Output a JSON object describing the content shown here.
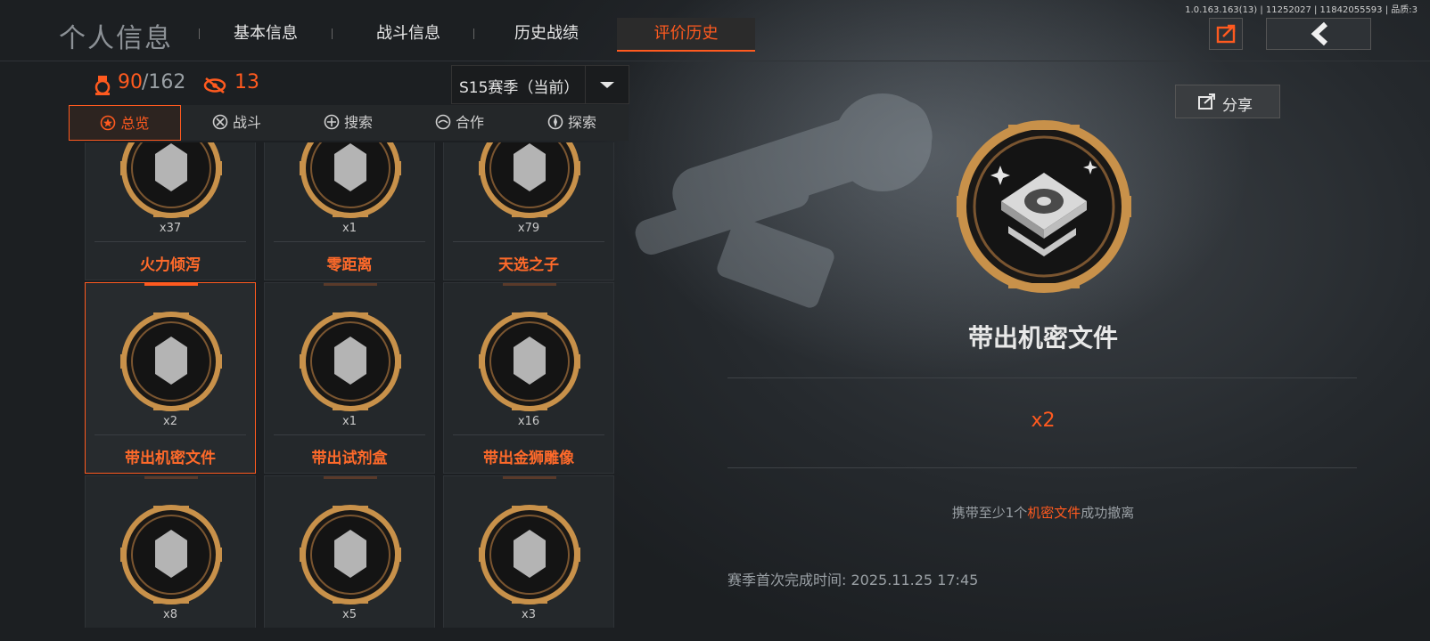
{
  "debug_text": "1.0.163.163(13) | 11252027 | 11842055593 | 品质:3",
  "header": {
    "title": "个人信息",
    "tabs": [
      {
        "label": "基本信息",
        "active": false
      },
      {
        "label": "战斗信息",
        "active": false
      },
      {
        "label": "历史战绩",
        "active": false
      },
      {
        "label": "评价历史",
        "active": true
      }
    ],
    "export_icon": "export-icon",
    "back_icon": "back-arrow-icon"
  },
  "stats": {
    "completed": "90",
    "total": "/162",
    "watch_count": "13"
  },
  "season": {
    "selected": "S15赛季（当前）"
  },
  "subtabs": [
    {
      "label": "总览",
      "icon": "star-icon",
      "active": true
    },
    {
      "label": "战斗",
      "icon": "crossed-swords-icon",
      "active": false
    },
    {
      "label": "搜索",
      "icon": "search-icon",
      "active": false
    },
    {
      "label": "合作",
      "icon": "handshake-icon",
      "active": false
    },
    {
      "label": "探索",
      "icon": "compass-icon",
      "active": false
    }
  ],
  "badges": [
    {
      "name": "火力倾泻",
      "count": "x37",
      "icon": "weapon-badge-icon"
    },
    {
      "name": "零距离",
      "count": "x1",
      "icon": "knife-badge-icon"
    },
    {
      "name": "天选之子",
      "count": "x79",
      "icon": "loot-pile-badge-icon"
    },
    {
      "name": "带出机密文件",
      "count": "x2",
      "icon": "hard-drive-badge-icon",
      "selected": true
    },
    {
      "name": "带出试剂盒",
      "count": "x1",
      "icon": "reagent-box-badge-icon"
    },
    {
      "name": "带出金狮雕像",
      "count": "x16",
      "icon": "lion-statue-badge-icon"
    },
    {
      "name": "",
      "count": "x8",
      "icon": "bust-statue-badge-icon"
    },
    {
      "name": "",
      "count": "x5",
      "icon": "teapot-badge-icon"
    },
    {
      "name": "",
      "count": "x3",
      "icon": "honeycomb-badge-icon"
    }
  ],
  "detail": {
    "share_label": "分享",
    "title": "带出机密文件",
    "count": "x2",
    "desc_pre": "携带至少1个",
    "desc_highlight": "机密文件",
    "desc_post": "成功撤离",
    "first_time_label": "赛季首次完成时间:",
    "first_time_value": "2025.11.25 17:45"
  },
  "colors": {
    "accent": "#ff5a1f",
    "gold": "#c8914a",
    "bg": "#1b1e21"
  }
}
